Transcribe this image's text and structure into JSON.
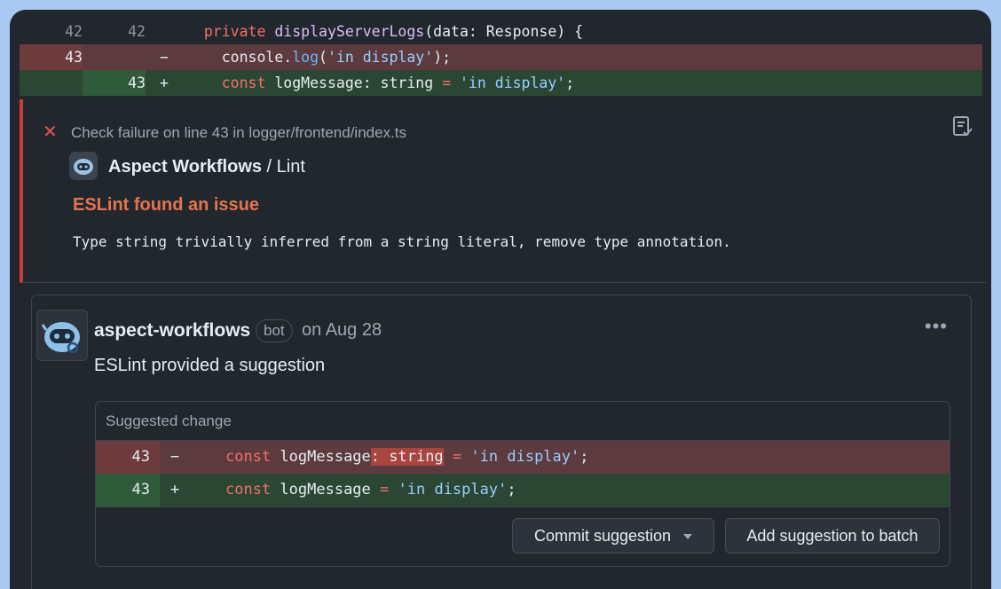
{
  "diff": {
    "lines": [
      {
        "old": "42",
        "new": "42",
        "sign": "",
        "kind": "context",
        "tokens": [
          {
            "t": "  ",
            "c": ""
          },
          {
            "t": "private",
            "c": "kw"
          },
          {
            "t": " ",
            "c": ""
          },
          {
            "t": "displayServerLogs",
            "c": "fn"
          },
          {
            "t": "(data: Response) {",
            "c": ""
          }
        ]
      },
      {
        "old": "43",
        "new": "",
        "sign": "−",
        "kind": "del",
        "tokens": [
          {
            "t": "    console.",
            "c": ""
          },
          {
            "t": "log",
            "c": "prop"
          },
          {
            "t": "(",
            "c": ""
          },
          {
            "t": "'in display'",
            "c": "str"
          },
          {
            "t": ");",
            "c": ""
          }
        ]
      },
      {
        "old": "",
        "new": "43",
        "sign": "+",
        "kind": "add",
        "tokens": [
          {
            "t": "    ",
            "c": ""
          },
          {
            "t": "const",
            "c": "kw"
          },
          {
            "t": " logMessage: string ",
            "c": ""
          },
          {
            "t": "=",
            "c": "kw"
          },
          {
            "t": " ",
            "c": ""
          },
          {
            "t": "'in display'",
            "c": "str"
          },
          {
            "t": ";",
            "c": ""
          }
        ]
      }
    ]
  },
  "check": {
    "failure_text": "Check failure on line 43 in logger/frontend/index.ts",
    "app_name": "Aspect Workflows",
    "app_separator": " / ",
    "check_name": "Lint",
    "issue_title": "ESLint found an issue",
    "issue_message": "Type string trivially inferred from a string literal, remove type annotation.",
    "icons": {
      "close": "x-icon",
      "file": "file-check-icon"
    },
    "accent_color": "#e5534b"
  },
  "comment": {
    "author": "aspect-workflows",
    "badge": "bot",
    "date": "on Aug 28",
    "more": "•••",
    "body": "ESLint provided a suggestion",
    "suggestion": {
      "header": "Suggested change",
      "lines": [
        {
          "num": "43",
          "sign": "−",
          "kind": "del",
          "tokens": [
            {
              "t": "const",
              "c": "kw"
            },
            {
              "t": " logMessage",
              "c": ""
            },
            {
              "t": ": string",
              "c": "hl"
            },
            {
              "t": " ",
              "c": ""
            },
            {
              "t": "=",
              "c": "kw"
            },
            {
              "t": " ",
              "c": ""
            },
            {
              "t": "'in display'",
              "c": "str"
            },
            {
              "t": ";",
              "c": ""
            }
          ]
        },
        {
          "num": "43",
          "sign": "+",
          "kind": "add",
          "tokens": [
            {
              "t": "const",
              "c": "kw"
            },
            {
              "t": " logMessage ",
              "c": ""
            },
            {
              "t": "=",
              "c": "kw"
            },
            {
              "t": " ",
              "c": ""
            },
            {
              "t": "'in display'",
              "c": "str"
            },
            {
              "t": ";",
              "c": ""
            }
          ]
        }
      ],
      "commit_label": "Commit suggestion",
      "batch_label": "Add suggestion to batch"
    }
  }
}
